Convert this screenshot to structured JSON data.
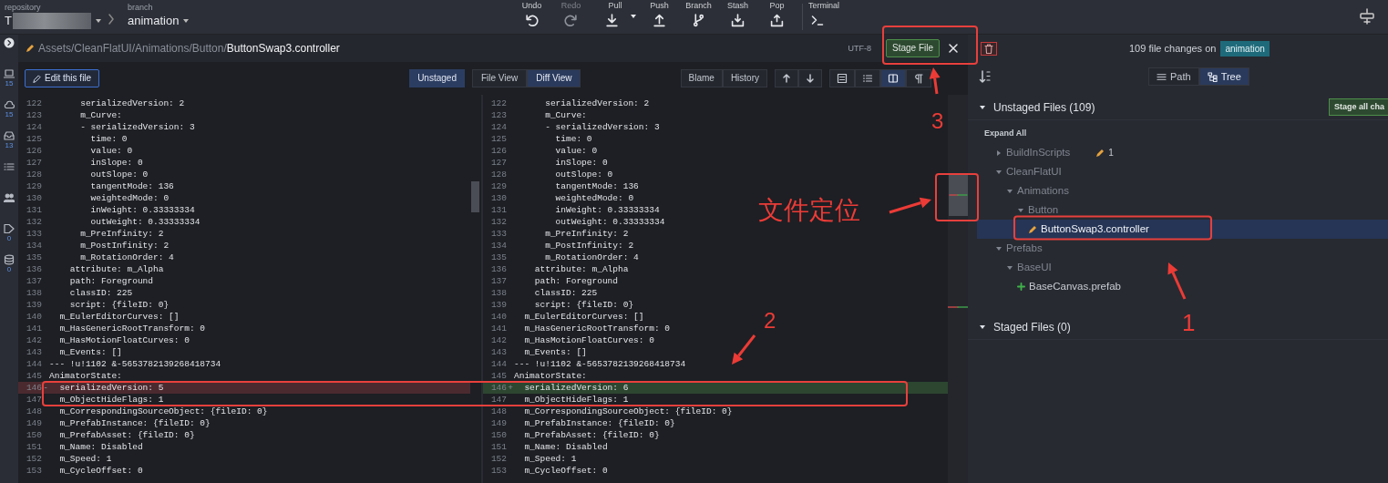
{
  "toolbar": {
    "repository_label": "repository",
    "repository_name": "T",
    "branch_label": "branch",
    "branch_name": "animation",
    "actions": [
      {
        "label": "Undo",
        "kind": "undo",
        "disabled": false
      },
      {
        "label": "Redo",
        "kind": "redo",
        "disabled": true
      },
      {
        "label": "Pull",
        "kind": "pull",
        "disabled": false
      },
      {
        "label": "Push",
        "kind": "push",
        "disabled": false
      },
      {
        "label": "Branch",
        "kind": "branch",
        "disabled": false
      },
      {
        "label": "Stash",
        "kind": "stash",
        "disabled": false
      },
      {
        "label": "Pop",
        "kind": "pop",
        "disabled": false
      }
    ],
    "terminal_label": "Terminal"
  },
  "rail": [
    {
      "kind": "toggle"
    },
    {
      "kind": "local",
      "count": "15"
    },
    {
      "kind": "remote",
      "count": "15"
    },
    {
      "kind": "pull_requests",
      "count": "13"
    },
    {
      "kind": "issues"
    },
    {
      "kind": "teams"
    },
    {
      "kind": "tags",
      "count": "0"
    },
    {
      "kind": "stashes",
      "count": "0"
    }
  ],
  "file_header": {
    "path": "Assets/CleanFlatUI/Animations/Button/",
    "file_name": "ButtonSwap3.controller",
    "encoding": "UTF-8",
    "stage_button": "Stage File"
  },
  "diff_toolbar": {
    "edit_button": "Edit this file",
    "status_badge": "Unstaged",
    "views": [
      {
        "label": "File View",
        "selected": false
      },
      {
        "label": "Diff View",
        "selected": true
      }
    ],
    "history_buttons": [
      "Blame",
      "History"
    ],
    "layouts": [
      {
        "kind": "inline",
        "selected": false
      },
      {
        "kind": "list",
        "selected": false
      },
      {
        "kind": "split",
        "selected": true
      },
      {
        "kind": "whitespace",
        "selected": false
      }
    ]
  },
  "diff": {
    "left": [
      {
        "number": "122",
        "text": "      serializedVersion: 2",
        "kind": "context"
      },
      {
        "number": "123",
        "text": "      m_Curve:",
        "kind": "context"
      },
      {
        "number": "124",
        "text": "      - serializedVersion: 3",
        "kind": "context"
      },
      {
        "number": "125",
        "text": "        time: 0",
        "kind": "context"
      },
      {
        "number": "126",
        "text": "        value: 0",
        "kind": "context"
      },
      {
        "number": "127",
        "text": "        inSlope: 0",
        "kind": "context"
      },
      {
        "number": "128",
        "text": "        outSlope: 0",
        "kind": "context"
      },
      {
        "number": "129",
        "text": "        tangentMode: 136",
        "kind": "context"
      },
      {
        "number": "130",
        "text": "        weightedMode: 0",
        "kind": "context"
      },
      {
        "number": "131",
        "text": "        inWeight: 0.33333334",
        "kind": "context"
      },
      {
        "number": "132",
        "text": "        outWeight: 0.33333334",
        "kind": "context"
      },
      {
        "number": "133",
        "text": "      m_PreInfinity: 2",
        "kind": "context"
      },
      {
        "number": "134",
        "text": "      m_PostInfinity: 2",
        "kind": "context"
      },
      {
        "number": "135",
        "text": "      m_RotationOrder: 4",
        "kind": "context"
      },
      {
        "number": "136",
        "text": "    attribute: m_Alpha",
        "kind": "context"
      },
      {
        "number": "137",
        "text": "    path: Foreground",
        "kind": "context"
      },
      {
        "number": "138",
        "text": "    classID: 225",
        "kind": "context"
      },
      {
        "number": "139",
        "text": "    script: {fileID: 0}",
        "kind": "context"
      },
      {
        "number": "140",
        "text": "  m_EulerEditorCurves: []",
        "kind": "context"
      },
      {
        "number": "141",
        "text": "  m_HasGenericRootTransform: 0",
        "kind": "context"
      },
      {
        "number": "142",
        "text": "  m_HasMotionFloatCurves: 0",
        "kind": "context"
      },
      {
        "number": "143",
        "text": "  m_Events: []",
        "kind": "context"
      },
      {
        "number": "144",
        "text": "--- !u!1102 &-5653782139268418734",
        "kind": "context"
      },
      {
        "number": "145",
        "text": "AnimatorState:",
        "kind": "context"
      },
      {
        "number": "146",
        "marker": "-",
        "text": "  serializedVersion: 5",
        "kind": "removed"
      },
      {
        "number": "147",
        "text": "  m_ObjectHideFlags: 1",
        "kind": "context"
      },
      {
        "number": "148",
        "text": "  m_CorrespondingSourceObject: {fileID: 0}",
        "kind": "context"
      },
      {
        "number": "149",
        "text": "  m_PrefabInstance: {fileID: 0}",
        "kind": "context"
      },
      {
        "number": "150",
        "text": "  m_PrefabAsset: {fileID: 0}",
        "kind": "context"
      },
      {
        "number": "151",
        "text": "  m_Name: Disabled",
        "kind": "context"
      },
      {
        "number": "152",
        "text": "  m_Speed: 1",
        "kind": "context"
      },
      {
        "number": "153",
        "text": "  m_CycleOffset: 0",
        "kind": "context"
      }
    ],
    "right": [
      {
        "number": "122",
        "text": "      serializedVersion: 2",
        "kind": "context"
      },
      {
        "number": "123",
        "text": "      m_Curve:",
        "kind": "context"
      },
      {
        "number": "124",
        "text": "      - serializedVersion: 3",
        "kind": "context"
      },
      {
        "number": "125",
        "text": "        time: 0",
        "kind": "context"
      },
      {
        "number": "126",
        "text": "        value: 0",
        "kind": "context"
      },
      {
        "number": "127",
        "text": "        inSlope: 0",
        "kind": "context"
      },
      {
        "number": "128",
        "text": "        outSlope: 0",
        "kind": "context"
      },
      {
        "number": "129",
        "text": "        tangentMode: 136",
        "kind": "context"
      },
      {
        "number": "130",
        "text": "        weightedMode: 0",
        "kind": "context"
      },
      {
        "number": "131",
        "text": "        inWeight: 0.33333334",
        "kind": "context"
      },
      {
        "number": "132",
        "text": "        outWeight: 0.33333334",
        "kind": "context"
      },
      {
        "number": "133",
        "text": "      m_PreInfinity: 2",
        "kind": "context"
      },
      {
        "number": "134",
        "text": "      m_PostInfinity: 2",
        "kind": "context"
      },
      {
        "number": "135",
        "text": "      m_RotationOrder: 4",
        "kind": "context"
      },
      {
        "number": "136",
        "text": "    attribute: m_Alpha",
        "kind": "context"
      },
      {
        "number": "137",
        "text": "    path: Foreground",
        "kind": "context"
      },
      {
        "number": "138",
        "text": "    classID: 225",
        "kind": "context"
      },
      {
        "number": "139",
        "text": "    script: {fileID: 0}",
        "kind": "context"
      },
      {
        "number": "140",
        "text": "  m_EulerEditorCurves: []",
        "kind": "context"
      },
      {
        "number": "141",
        "text": "  m_HasGenericRootTransform: 0",
        "kind": "context"
      },
      {
        "number": "142",
        "text": "  m_HasMotionFloatCurves: 0",
        "kind": "context"
      },
      {
        "number": "143",
        "text": "  m_Events: []",
        "kind": "context"
      },
      {
        "number": "144",
        "text": "--- !u!1102 &-5653782139268418734",
        "kind": "context"
      },
      {
        "number": "145",
        "text": "AnimatorState:",
        "kind": "context"
      },
      {
        "number": "146",
        "marker": "+",
        "text": "  serializedVersion: 6",
        "kind": "added"
      },
      {
        "number": "147",
        "text": "  m_ObjectHideFlags: 1",
        "kind": "context"
      },
      {
        "number": "148",
        "text": "  m_CorrespondingSourceObject: {fileID: 0}",
        "kind": "context"
      },
      {
        "number": "149",
        "text": "  m_PrefabInstance: {fileID: 0}",
        "kind": "context"
      },
      {
        "number": "150",
        "text": "  m_PrefabAsset: {fileID: 0}",
        "kind": "context"
      },
      {
        "number": "151",
        "text": "  m_Name: Disabled",
        "kind": "context"
      },
      {
        "number": "152",
        "text": "  m_Speed: 1",
        "kind": "context"
      },
      {
        "number": "153",
        "text": "  m_CycleOffset: 0",
        "kind": "context"
      }
    ]
  },
  "changes_header": {
    "summary": "109 file changes on",
    "branch": "animation"
  },
  "file_panel": {
    "modes": [
      {
        "label": "Path",
        "selected": false
      },
      {
        "label": "Tree",
        "selected": true
      }
    ],
    "unstaged": {
      "title": "Unstaged Files (109)",
      "expanded": true,
      "stage_all": "Stage all cha",
      "expand_all": "Expand All",
      "tree": [
        {
          "name": "BuildInScripts",
          "kind": "changed_folder",
          "expanded": false,
          "selected": false,
          "count": "1"
        },
        {
          "name": "CleanFlatUI",
          "kind": "folder",
          "expanded": true,
          "selected": false,
          "children": [
            {
              "name": "Animations",
              "kind": "folder",
              "expanded": true,
              "selected": false,
              "children": [
                {
                  "name": "Button",
                  "kind": "folder",
                  "expanded": true,
                  "selected": false,
                  "children": [
                    {
                      "name": "ButtonSwap3.controller",
                      "kind": "modified_file",
                      "selected": true
                    }
                  ]
                }
              ]
            }
          ]
        },
        {
          "name": "Prefabs",
          "kind": "folder",
          "expanded": true,
          "selected": false,
          "children": [
            {
              "name": "BaseUI",
              "kind": "folder",
              "expanded": true,
              "selected": false,
              "children": [
                {
                  "name": "BaseCanvas.prefab",
                  "kind": "added_file",
                  "selected": false
                }
              ]
            }
          ]
        }
      ]
    },
    "staged": {
      "title": "Staged Files (0)",
      "expanded": true
    }
  },
  "annotations": [
    {
      "label": "3"
    },
    {
      "label": "文件定位"
    },
    {
      "label": "2"
    },
    {
      "label": "1"
    }
  ]
}
